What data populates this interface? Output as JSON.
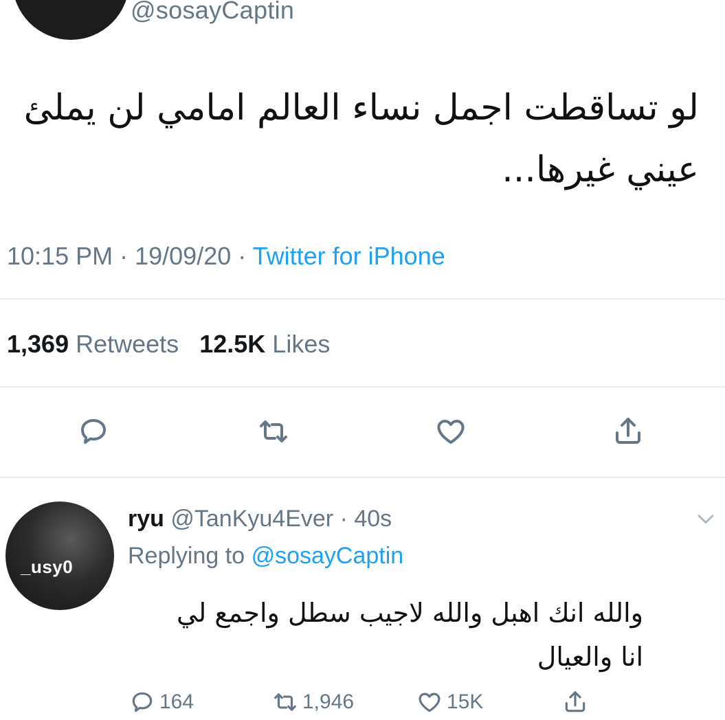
{
  "tweet": {
    "handle": "@sosayCaptin",
    "text_line1": "لو تساقطت اجمل نساء العالم امامي لن يملئ",
    "text_line2": "عيني غيرها...",
    "time": "10:15 PM",
    "date": "19/09/20",
    "source": "Twitter for iPhone",
    "retweets_count": "1,369",
    "retweets_label": "Retweets",
    "likes_count": "12.5K",
    "likes_label": "Likes"
  },
  "actions": {
    "reply_icon": "comment-icon",
    "retweet_icon": "retweet-icon",
    "like_icon": "heart-icon",
    "share_icon": "share-icon"
  },
  "reply": {
    "avatar_text": "_usy0",
    "name": "ryu",
    "handle": "@TanKyu4Ever",
    "time": "40s",
    "replying_label": "Replying to",
    "replying_to": "@sosayCaptin",
    "text_line1": "والله انك اهبل والله لاجيب سطل واجمع لي",
    "text_line2": "انا والعيال",
    "replies": "164",
    "retweets": "1,946",
    "likes": "15K"
  },
  "colors": {
    "text": "#14171a",
    "secondary": "#657786",
    "link": "#1da1f2",
    "divider": "#e6ecf0"
  }
}
